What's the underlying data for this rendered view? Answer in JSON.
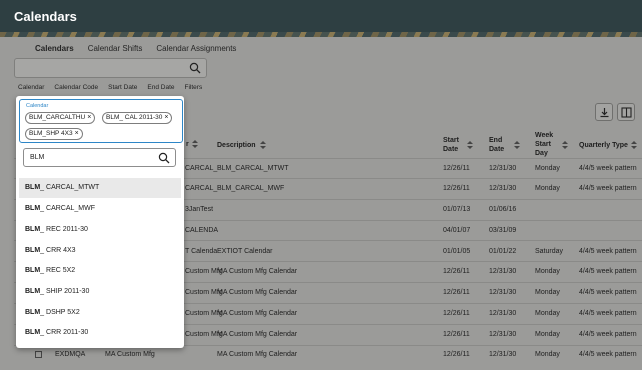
{
  "app": {
    "title": "Calendars"
  },
  "tabs": [
    {
      "label": "Calendars",
      "active": true
    },
    {
      "label": "Calendar Shifts",
      "active": false
    },
    {
      "label": "Calendar Assignments",
      "active": false
    }
  ],
  "filters": [
    "Calendar",
    "Calendar Code",
    "Start Date",
    "End Date",
    "Filters"
  ],
  "table": {
    "headers": {
      "col2_partial": "r",
      "description": "Description",
      "start_date_1": "Start",
      "start_date_2": "Date",
      "end_date_1": "End",
      "end_date_2": "Date",
      "week_start_1": "Week",
      "week_start_2": "Start",
      "week_start_3": "Day",
      "quarterly_type": "Quarterly Type"
    },
    "rows": [
      {
        "calendar": "",
        "code": "CARCAL_",
        "description": "BLM_CARCAL_MTWT",
        "start": "12/26/11",
        "end": "12/31/30",
        "week_start": "Monday",
        "quarterly": "4/4/5 week pattern"
      },
      {
        "calendar": "",
        "code": "CARCAL_",
        "description": "BLM_CARCAL_MWF",
        "start": "12/26/11",
        "end": "12/31/30",
        "week_start": "Monday",
        "quarterly": "4/4/5 week pattern"
      },
      {
        "calendar": "",
        "code": "3JanTest",
        "description": "",
        "start": "01/07/13",
        "end": "01/06/16",
        "week_start": "",
        "quarterly": ""
      },
      {
        "calendar": "",
        "code": "CALENDA",
        "description": "",
        "start": "04/01/07",
        "end": "03/31/09",
        "week_start": "",
        "quarterly": ""
      },
      {
        "calendar": "",
        "code": "T Calenda",
        "description": "EXTIOT Calendar",
        "start": "01/01/05",
        "end": "01/01/22",
        "week_start": "Saturday",
        "quarterly": "4/4/5 week pattern"
      },
      {
        "calendar": "",
        "code": "Custom Mfg",
        "description": "MA Custom Mfg Calendar",
        "start": "12/26/11",
        "end": "12/31/30",
        "week_start": "Monday",
        "quarterly": "4/4/5 week pattern"
      },
      {
        "calendar": "",
        "code": "Custom Mfg",
        "description": "MA Custom Mfg Calendar",
        "start": "12/26/11",
        "end": "12/31/30",
        "week_start": "Monday",
        "quarterly": "4/4/5 week pattern"
      },
      {
        "calendar": "",
        "code": "Custom Mfg",
        "description": "MA Custom Mfg Calendar",
        "start": "12/26/11",
        "end": "12/31/30",
        "week_start": "Monday",
        "quarterly": "4/4/5 week pattern"
      },
      {
        "calendar": "",
        "code": "Custom Mfg",
        "description": "MA Custom Mfg Calendar",
        "start": "12/26/11",
        "end": "12/31/30",
        "week_start": "Monday",
        "quarterly": "4/4/5 week pattern"
      },
      {
        "calendar": "EXDMQA",
        "code": "MA Custom Mfg",
        "description": "MA Custom Mfg Calendar",
        "start": "12/26/11",
        "end": "12/31/30",
        "week_start": "Monday",
        "quarterly": "4/4/5 week pattern"
      }
    ]
  },
  "dropdown": {
    "label": "Calendar",
    "chips": [
      "BLM_CARCALTHU",
      "BLM_ CAL 2011-30",
      "BLM_SHP 4X3"
    ],
    "search_value": "BLM",
    "options": [
      {
        "bold": "BLM",
        "rest": "_ CARCAL_MTWT"
      },
      {
        "bold": "BLM",
        "rest": "_ CARCAL_MWF"
      },
      {
        "bold": "BLM",
        "rest": "_ REC 2011-30"
      },
      {
        "bold": "BLM",
        "rest": "_ CRR 4X3"
      },
      {
        "bold": "BLM",
        "rest": "_ REC 5X2"
      },
      {
        "bold": "BLM",
        "rest": "_ SHIP 2011-30"
      },
      {
        "bold": "BLM",
        "rest": "_ DSHP 5X2"
      },
      {
        "bold": "BLM",
        "rest": "_ CRR 2011-30"
      }
    ]
  },
  "colors": {
    "topbar": "#2e3f42",
    "accent": "#2d86c7",
    "overlay": "#9b9b99"
  }
}
